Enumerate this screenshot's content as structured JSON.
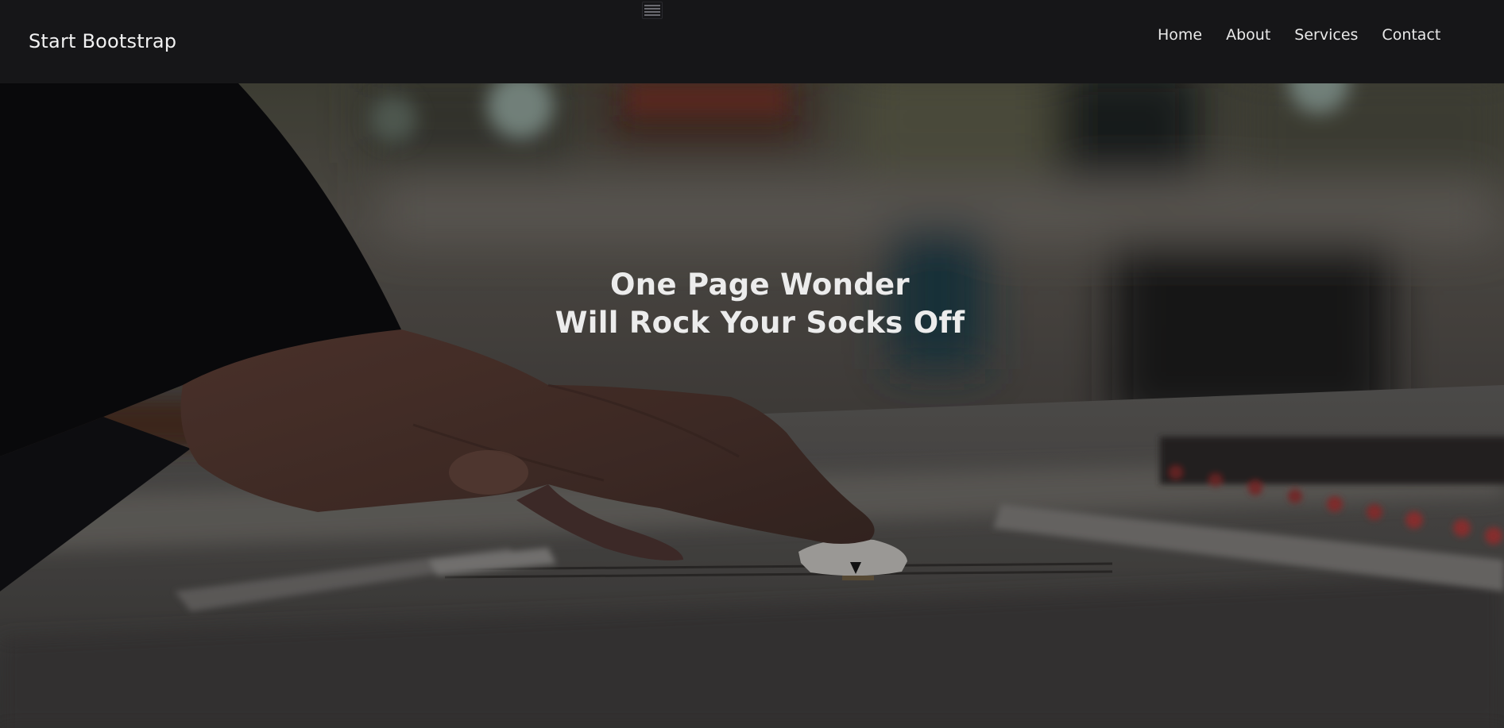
{
  "navbar": {
    "brand": "Start Bootstrap",
    "toggler_icon": "hamburger-menu-icon",
    "links": [
      {
        "label": "Home"
      },
      {
        "label": "About"
      },
      {
        "label": "Services"
      },
      {
        "label": "Contact"
      }
    ]
  },
  "hero": {
    "heading_line1": "One Page Wonder",
    "heading_line2": "Will Rock Your Socks Off",
    "background_image": "hand-on-audio-mixing-console-fader-photo"
  },
  "colors": {
    "navbar_bg": "#161618",
    "text_light": "#ececec"
  }
}
